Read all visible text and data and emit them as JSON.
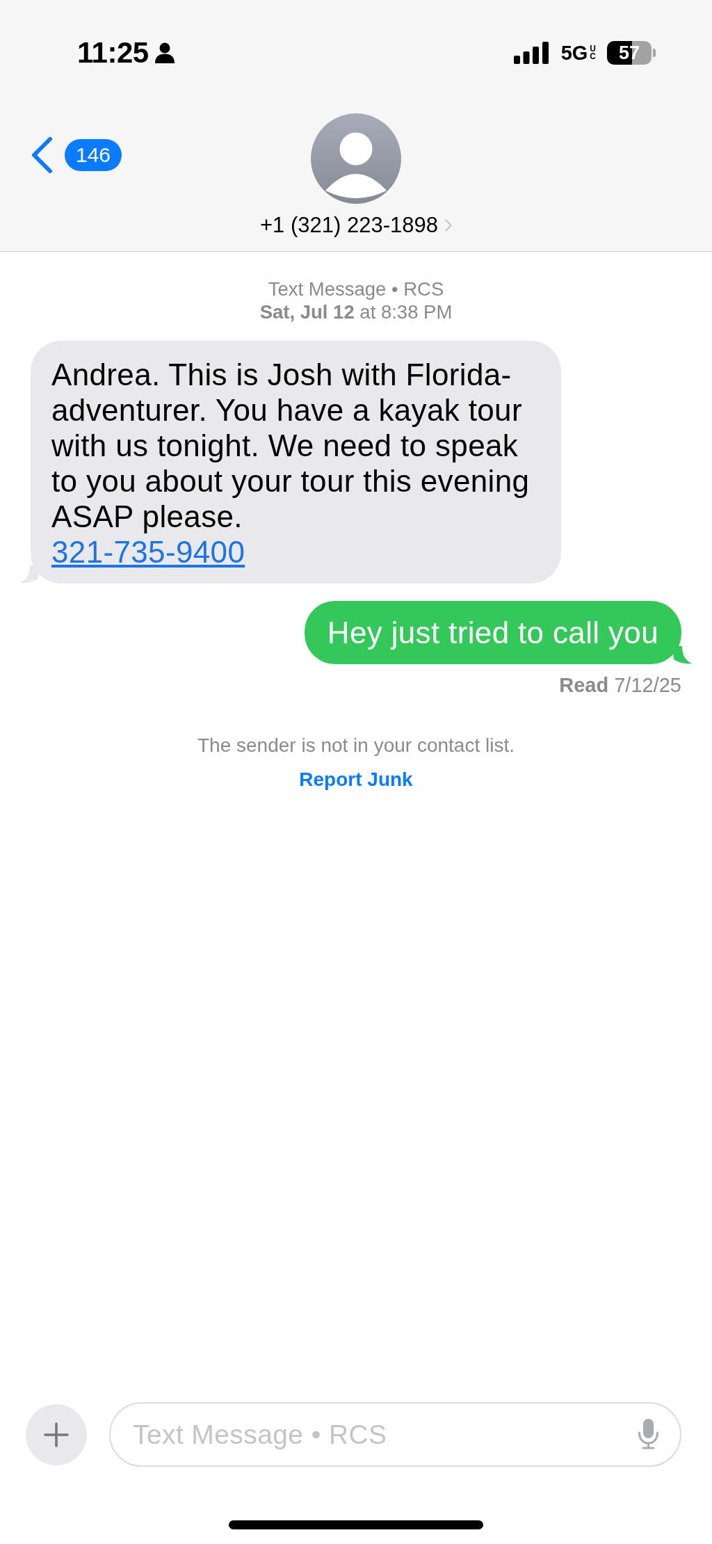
{
  "status_bar": {
    "time": "11:25",
    "network": "5G",
    "network_sub": "UC",
    "battery": "57"
  },
  "header": {
    "unread_count": "146",
    "contact": "+1 (321) 223-1898"
  },
  "thread": {
    "service": "Text Message • RCS",
    "timestamp": "**Sat, Jul 12** at 8:38 PM"
  },
  "messages": [
    {
      "kind": "received",
      "text": "Andrea. This is Josh with Florida-adventurer. You have a kayak tour with us tonight. We need to speak to you about your tour this evening ASAP please.",
      "link": "321-735-9400"
    },
    {
      "kind": "sent",
      "text": "Hey just tried to call you"
    }
  ],
  "receipt": "**Read** 7/12/25",
  "notice": {
    "text": "The sender is not in your contact list.",
    "action": "Report Junk"
  },
  "composer": {
    "placeholder": "Text Message • RCS"
  }
}
